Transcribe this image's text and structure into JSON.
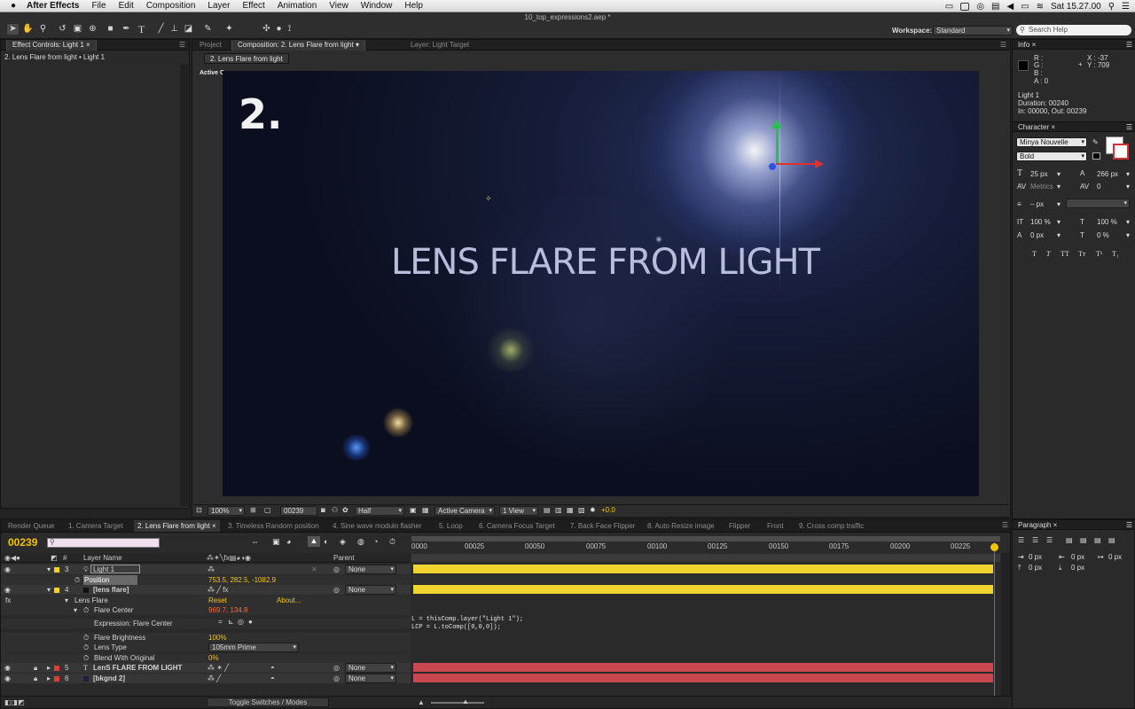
{
  "menubar": {
    "app": "After Effects",
    "items": [
      "File",
      "Edit",
      "Composition",
      "Layer",
      "Effect",
      "Animation",
      "View",
      "Window",
      "Help"
    ],
    "clock": "Sat 15.27.00"
  },
  "window_title": "10_top_expressions2.aep *",
  "workspace": {
    "label": "Workspace:",
    "value": "Standard"
  },
  "search_help": "Search Help",
  "effect_controls": {
    "tab": "Effect Controls: Light 1",
    "subtitle": "2. Lens Flare from light • Light 1"
  },
  "comp_tabs": {
    "project": "Project",
    "composition": "Composition: 2. Lens Flare from light",
    "layer": "Layer: Light Target",
    "subtab": "2. Lens Flare from light",
    "camera_label": "Active Camera"
  },
  "viewer": {
    "big_number": "2.",
    "title_text": "LENS FLARE FROM LIGHT"
  },
  "viewer_footer": {
    "zoom": "100%",
    "timecode": "00239",
    "resolution": "Half",
    "camera": "Active Camera",
    "views": "1 View",
    "exposure": "+0.0"
  },
  "info": {
    "tab": "Info",
    "r": "R :",
    "g": "G :",
    "b": "B :",
    "a": "A : 0",
    "x": "X : -37",
    "y": "Y : 709",
    "layer": "Light 1",
    "duration": "Duration: 00240",
    "inout": "In: 00000, Out: 00239"
  },
  "character": {
    "tab": "Character",
    "font": "Minya Nouvelle",
    "style": "Bold",
    "size": "25 px",
    "leading": "266 px",
    "kerning": "Metrics",
    "tracking": "0",
    "stroke": "– px",
    "vscale": "100 %",
    "hscale": "100 %",
    "baseline": "0 px",
    "tsume": "0 %",
    "styles": [
      "T",
      "T",
      "TT",
      "Tт",
      "T¹",
      "T₁"
    ]
  },
  "paragraph": {
    "tab": "Paragraph",
    "fields": [
      "0 px",
      "0 px",
      "0 px",
      "0 px",
      "0 px"
    ]
  },
  "timeline": {
    "tabs": [
      "Render Queue",
      "1. Camera Target",
      "2. Lens Flare from light",
      "3. Timeless Random position",
      "4. Sine wave modulo flasher",
      "5. Loop",
      "6. Camera Focus Target",
      "7. Back Face Flipper",
      "8. Auto Resize image",
      "Flipper",
      "Front",
      "9. Cross comp traffic"
    ],
    "timecode": "00239",
    "headers": {
      "num": "#",
      "layer_name": "Layer Name",
      "parent": "Parent"
    },
    "ruler": [
      "0000",
      "00025",
      "00050",
      "00075",
      "00100",
      "00125",
      "00150",
      "00175",
      "00200",
      "00225"
    ],
    "layers": {
      "l3": {
        "num": "3",
        "name": "Light 1",
        "parent": "None"
      },
      "position_label": "Position",
      "position_value": "753.5, 282.5, -1082.9",
      "l4": {
        "num": "4",
        "name": "[lens flare]",
        "parent": "None"
      },
      "fx": "fx",
      "lens_flare": "Lens Flare",
      "reset": "Reset",
      "about": "About...",
      "flare_center_label": "Flare Center",
      "flare_center_value": "969.7, 134.8",
      "expression_label": "Expression: Flare Center",
      "expression_line1": "L = thisComp.layer(\"Light 1\");",
      "expression_line2": "LCP = L.toComp([0,0,0]);",
      "flare_brightness_label": "Flare Brightness",
      "flare_brightness_value": "100%",
      "lens_type_label": "Lens Type",
      "lens_type_value": "105mm Prime",
      "blend_label": "Blend With Original",
      "blend_value": "0%",
      "l5": {
        "num": "5",
        "name": "LenS FLARE FROM LIGHT",
        "parent": "None"
      },
      "l6": {
        "num": "6",
        "name": "[bkgnd 2]",
        "parent": "None"
      }
    },
    "toggle": "Toggle Switches / Modes"
  },
  "colors": {
    "timecode": "#f5c400",
    "track_yellow": "#f2d430",
    "track_red": "#c9474f",
    "swatch_yellow": "#f5d020",
    "swatch_red": "#e03c3c"
  }
}
